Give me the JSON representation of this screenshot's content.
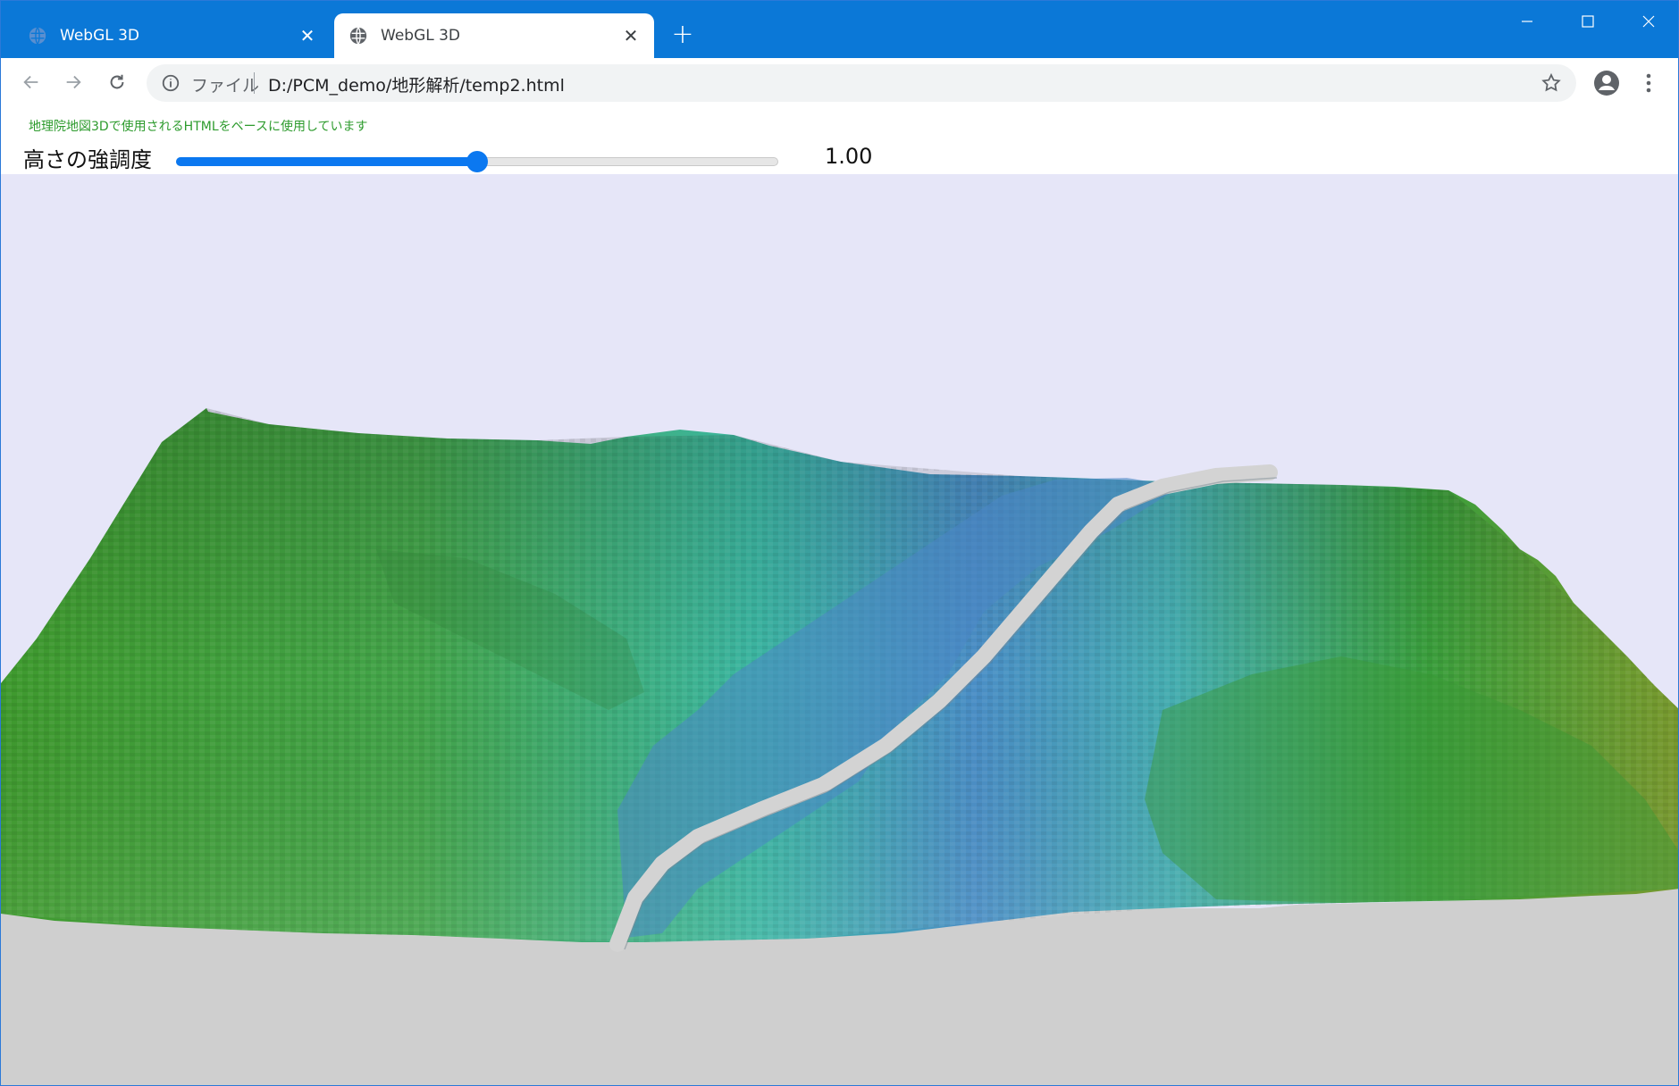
{
  "browser": {
    "tabs": [
      {
        "title": "WebGL 3D",
        "active": false
      },
      {
        "title": "WebGL 3D",
        "active": true
      }
    ],
    "address": {
      "scheme_label": "ファイル",
      "url": "D:/PCM_demo/地形解析/temp2.html"
    },
    "icons": [
      "globe-icon",
      "close-icon",
      "plus-icon",
      "minimize-icon",
      "maximize-icon",
      "window-close-icon",
      "back-arrow-icon",
      "forward-arrow-icon",
      "reload-icon",
      "info-icon",
      "star-icon",
      "profile-icon",
      "kebab-menu-icon"
    ],
    "accent_color": "#0b78d7"
  },
  "page": {
    "credit": "地理院地図3Dで使用されるHTMLをベースに使用しています",
    "height_label": "高さの強調度",
    "height_value": "1.00",
    "slider": {
      "min": 0,
      "max": 2,
      "value": 1.0
    },
    "scene_background": "#e6e6f8",
    "terrain_colors": [
      "#3f9a2e",
      "#3cb6a2",
      "#4a86c4",
      "#d3d3d3"
    ]
  }
}
